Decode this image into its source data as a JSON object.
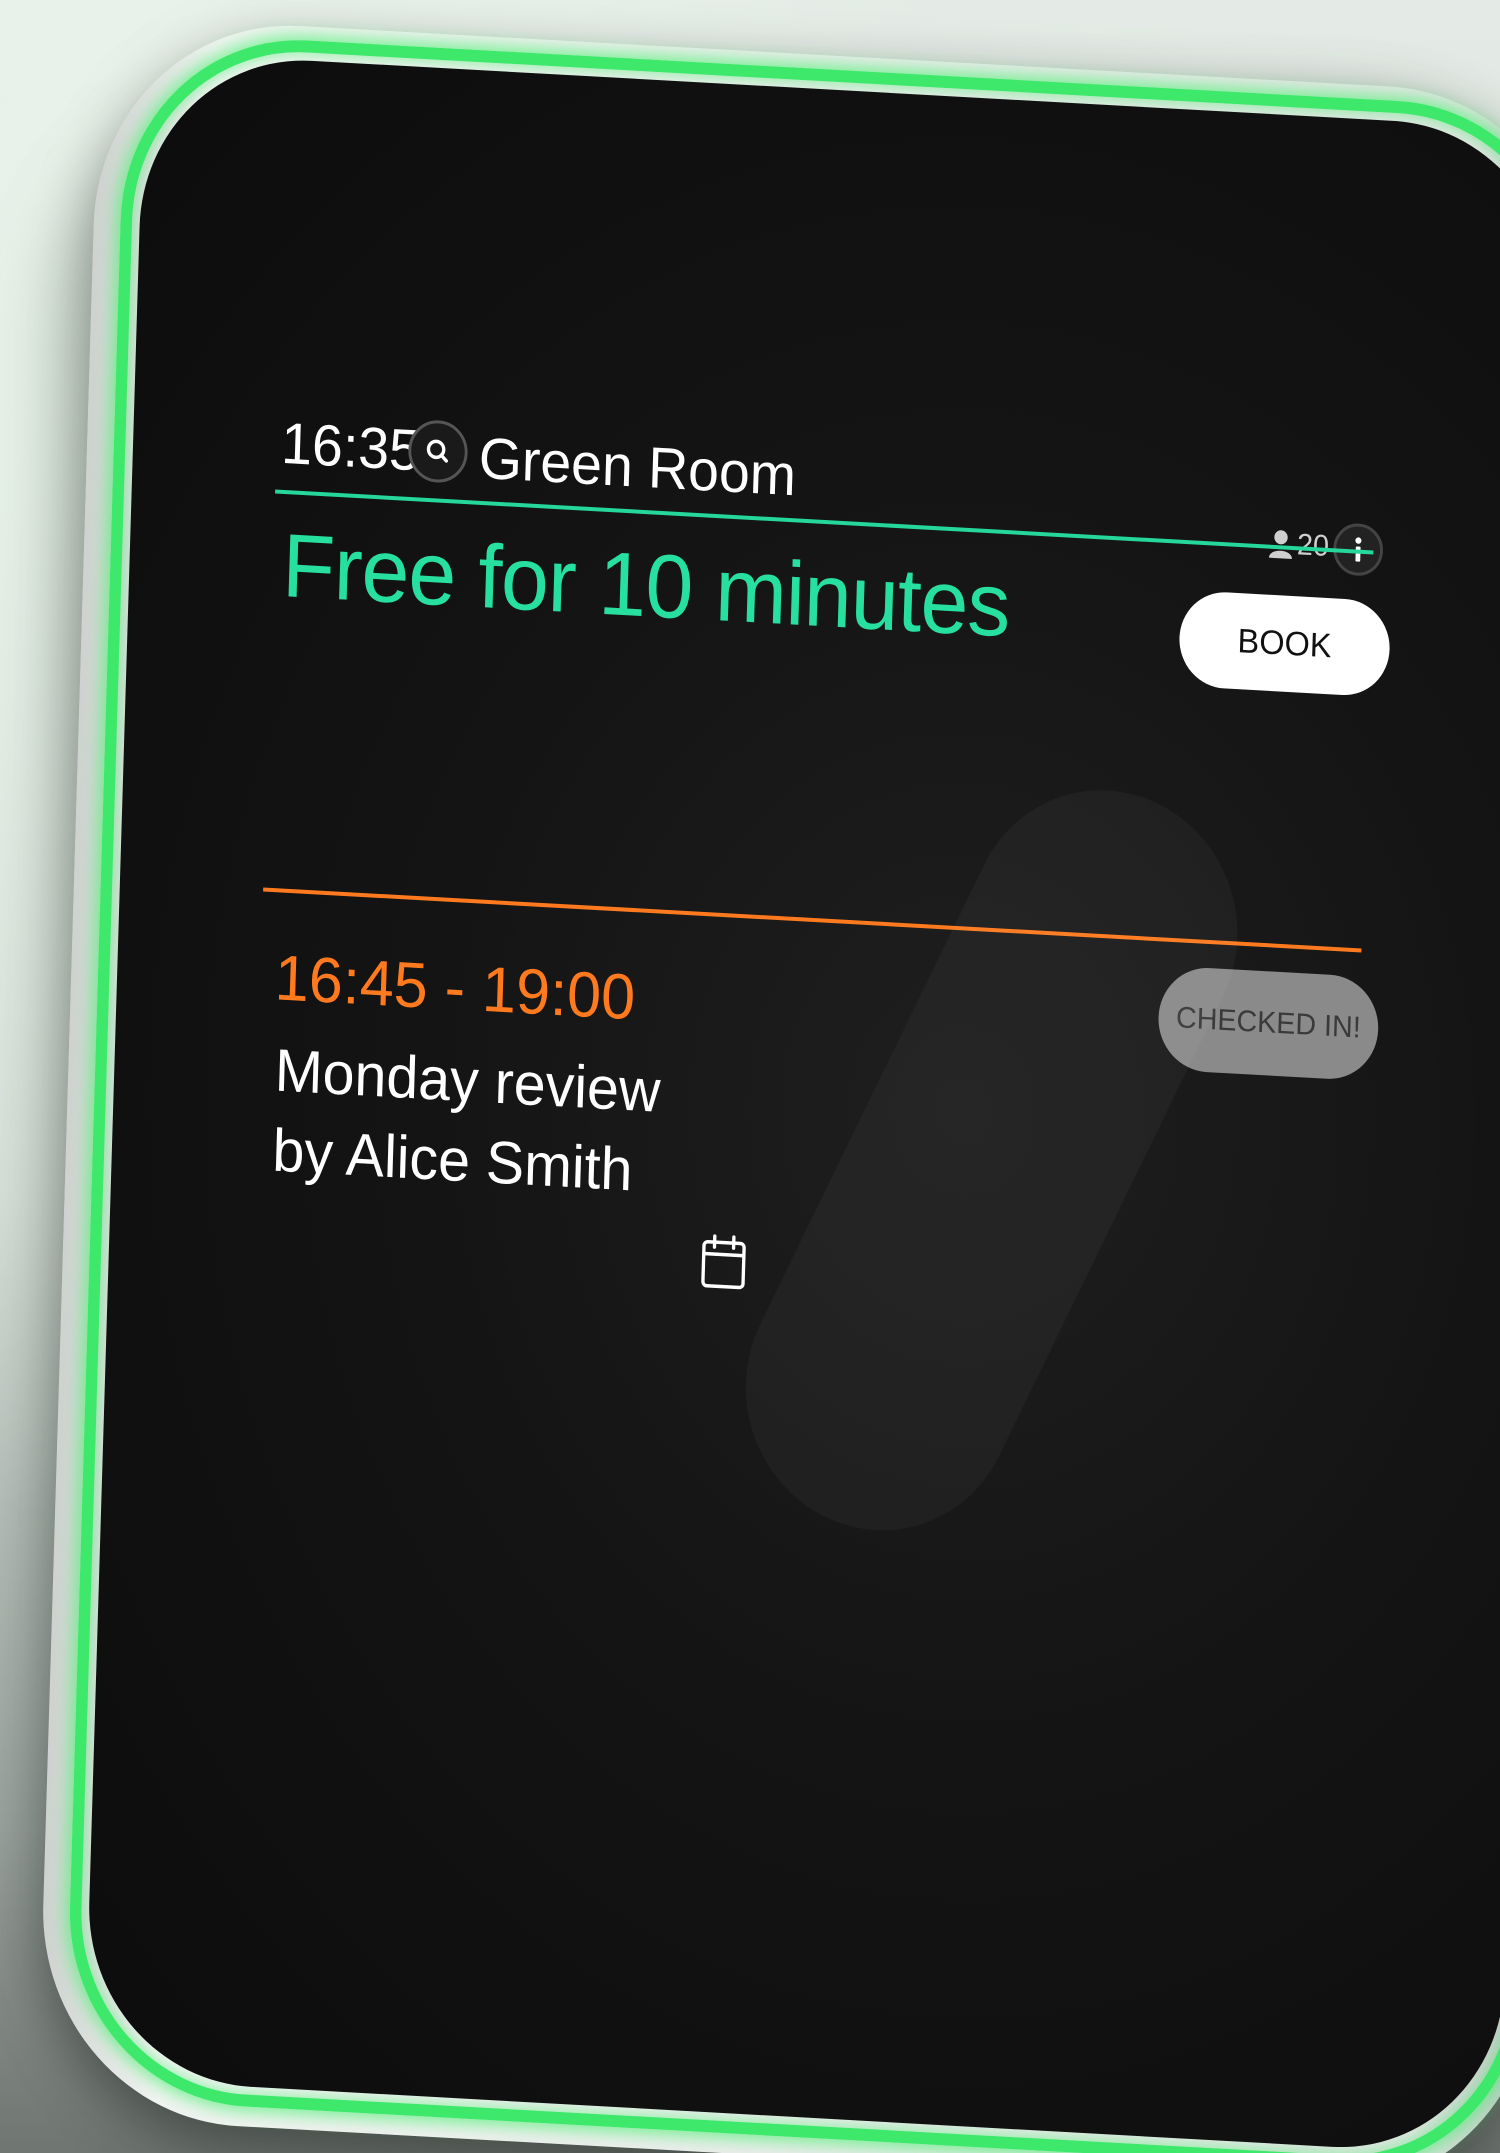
{
  "topbar": {
    "clock": "16:35",
    "room_name": "Green Room",
    "capacity": "20",
    "icons": {
      "search": "search-icon",
      "person": "person-icon",
      "info": "info-icon"
    }
  },
  "status": {
    "text": "Free for 10 minutes",
    "book_label": "BOOK"
  },
  "next_meeting": {
    "time_range": "16:45 - 19:00",
    "title": "Monday review",
    "organizer": "by Alice Smith",
    "checked_in_label": "CHECKED IN!"
  },
  "footer": {
    "calendar_icon": "calendar-icon"
  },
  "colors": {
    "free_accent": "#27e0a0",
    "busy_accent": "#ff7a1f",
    "led_ring": "#3ee86b",
    "screen_bg": "#141414"
  }
}
